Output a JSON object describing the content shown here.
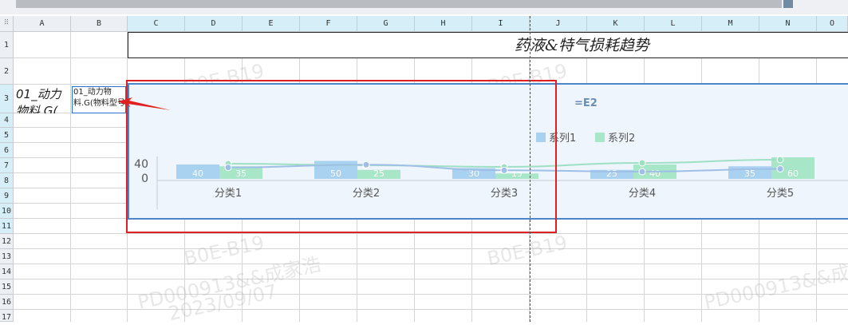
{
  "sheet": {
    "columns": [
      "A",
      "B",
      "C",
      "D",
      "E",
      "F",
      "G",
      "H",
      "I",
      "J",
      "K",
      "L",
      "M",
      "N",
      "O"
    ],
    "rows": [
      "1",
      "2",
      "3",
      "4",
      "5",
      "6",
      "7",
      "8",
      "9",
      "10",
      "11",
      "12",
      "13",
      "14",
      "15",
      "16",
      "17"
    ],
    "title": "药液&特气损耗趋势",
    "cell_a3": "01_动力物料.G(",
    "cell_b3": "01_动力物料.G(物料型号"
  },
  "watermark": {
    "lines": [
      "B0E-B19",
      "PD000913&&成家浩",
      "2023/09/07"
    ]
  },
  "chart": {
    "formula_label": "=E2",
    "colors": {
      "series1": "#a9d1f0",
      "series2": "#a8e6c8",
      "line1": "#9fbfe6",
      "line2": "#9fe0c4"
    }
  },
  "chart_data": {
    "type": "bar",
    "categories": [
      "分类1",
      "分类2",
      "分类3",
      "分类4",
      "分类5"
    ],
    "series": [
      {
        "name": "系列1",
        "values": [
          40,
          50,
          30,
          25,
          35
        ]
      },
      {
        "name": "系列2",
        "values": [
          35,
          25,
          15,
          40,
          60
        ]
      }
    ],
    "y_ticks": [
      "0",
      "40"
    ],
    "legend": "top"
  }
}
